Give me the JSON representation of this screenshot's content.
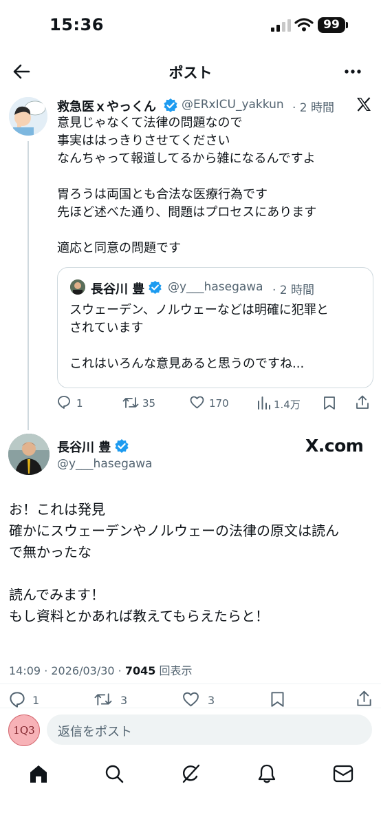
{
  "status_bar": {
    "time": "15:36",
    "battery": "99"
  },
  "header": {
    "title": "ポスト"
  },
  "main_post": {
    "display_name": "救急医ｘやっくん",
    "handle": "@ERxICU_yakkun",
    "time": "· 2 時間",
    "lines": [
      "意見じゃなくて法律の問題なので",
      "事実ははっきりさせてください",
      "なんちゃって報道してるから雑になるんですよ",
      "",
      "胃ろうは両国とも合法な医療行為です",
      "先ほど述べた通り、問題はプロセスにあります",
      "",
      "適応と同意の問題です"
    ],
    "text": "意見じゃなくて法律の問題なので\n事実ははっきりさせてください\nなんちゃって報道してるから雑になるんですよ\n\n胃ろうは両国とも合法な医療行為です\n先ほど述べた通り、問題はプロセスにあります\n\n適応と同意の問題です",
    "quote": {
      "display_name": "長谷川 豊",
      "handle": "@y___hasegawa",
      "time": "· 2 時間",
      "text": "スウェーデン、ノルウェーなどは明確に犯罪と\nされています\n\nこれはいろんな意見あると思うのですね..."
    },
    "stats": {
      "replies": "1",
      "reposts": "35",
      "likes": "170",
      "views": "1.4万"
    }
  },
  "reply_post": {
    "display_name": "長谷川 豊",
    "handle": "@y___hasegawa",
    "watermark": "X.com",
    "text": "お！これは発見\n確かにスウェーデンやノルウェーの法律の原文は読ん\nで無かったな\n\n読んでみます！\nもし資料とかあれば教えてもらえたらと！",
    "timestamp": "14:09 · 2026/03/30 · ",
    "views_count": "7045",
    "views_label": " 回表示",
    "stats": {
      "replies": "1",
      "reposts": "3",
      "likes": "3"
    }
  },
  "composer": {
    "placeholder": "返信をポスト",
    "avatar_text": "1Q3"
  },
  "colors": {
    "verified": "#1d9bf0",
    "text": "#0f1419",
    "muted": "#536471",
    "border": "#cfd9de"
  },
  "icons": {
    "back": "arrow-left-icon",
    "more": "more-icon",
    "x_logo": "x-logo-icon",
    "home": "home-icon",
    "search": "search-icon",
    "grok": "grok-icon",
    "notifications": "bell-icon",
    "messages": "mail-icon"
  }
}
